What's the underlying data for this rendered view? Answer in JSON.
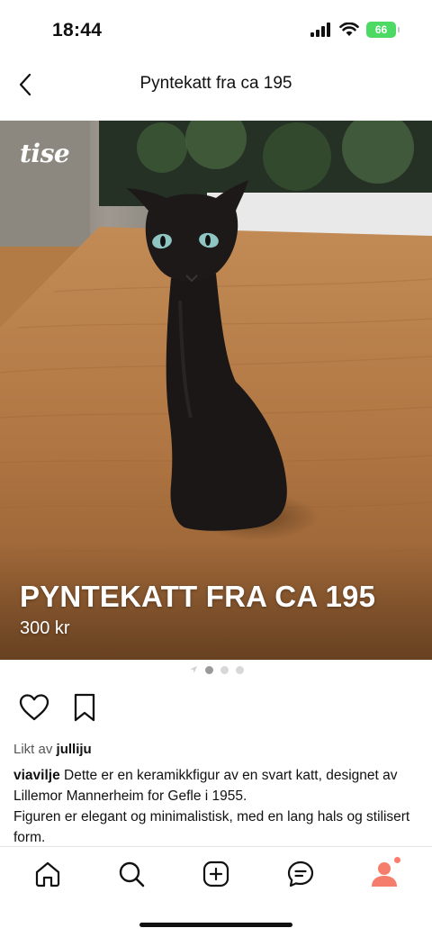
{
  "status_bar": {
    "time": "18:44",
    "battery": "66"
  },
  "header": {
    "title": "Pyntekatt fra ca 195",
    "back_icon": "chevron-left-icon"
  },
  "listing": {
    "brand": "tise",
    "title": "PYNTEKATT FRA CA 195",
    "price": "300 kr",
    "image_count": 3,
    "active_image": 1
  },
  "actions": {
    "like_icon": "heart-icon",
    "save_icon": "bookmark-icon"
  },
  "likes": {
    "prefix": "Likt av",
    "user": "julliju"
  },
  "description": {
    "user": "viavilje",
    "text_1": "Dette er en keramikkfigur av en svart katt, designet av Lillemor Mannerheim for Gefle i 1955.",
    "text_2": "Figuren er elegant og minimalistisk, med en lang hals og stilisert form."
  },
  "tabs": [
    {
      "icon": "home-icon"
    },
    {
      "icon": "search-icon"
    },
    {
      "icon": "add-icon"
    },
    {
      "icon": "messages-icon"
    },
    {
      "icon": "profile-icon"
    }
  ],
  "colors": {
    "accent": "#ff7b6b",
    "battery": "#4cd964",
    "profile": "#f47d6b"
  }
}
